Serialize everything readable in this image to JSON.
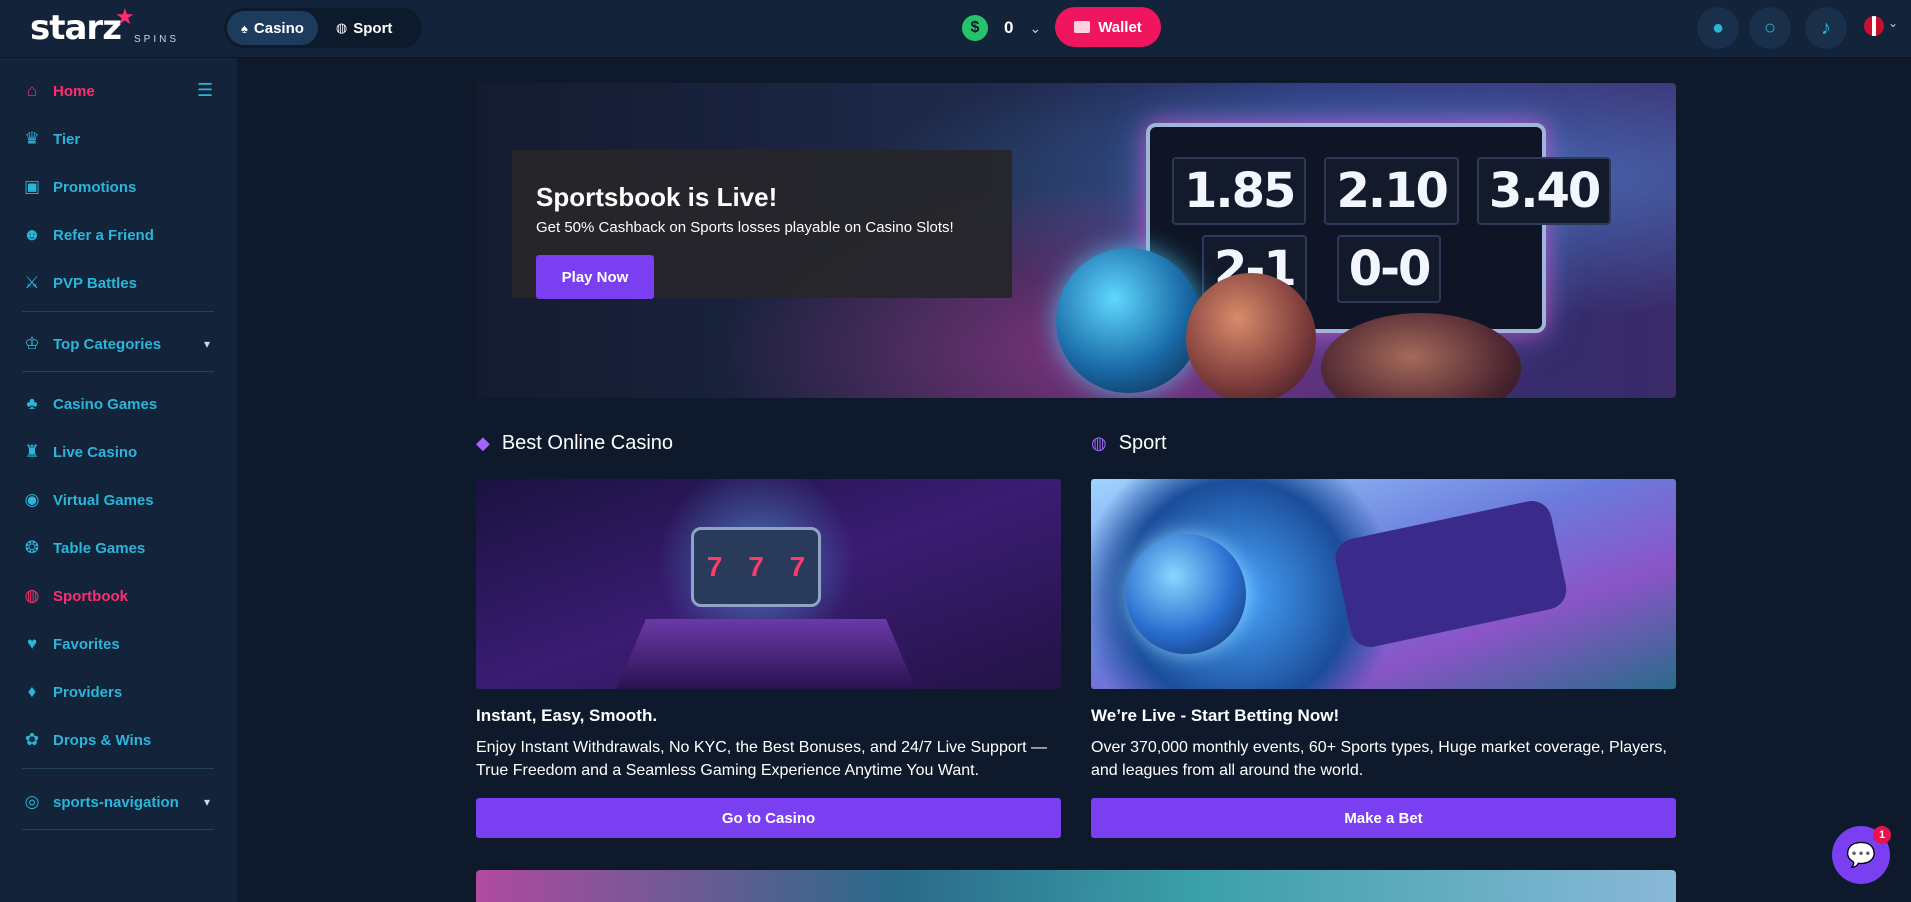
{
  "header": {
    "logo_text": "starz",
    "logo_sub": "SPINS",
    "tabs": [
      {
        "label": "Casino",
        "active": true
      },
      {
        "label": "Sport",
        "active": false
      }
    ],
    "balance": "0",
    "wallet_label": "Wallet"
  },
  "sidebar": {
    "items": [
      {
        "label": "Home",
        "icon": "home-icon",
        "active": true
      },
      {
        "label": "Tier",
        "icon": "trophy-icon"
      },
      {
        "label": "Promotions",
        "icon": "gift-icon"
      },
      {
        "label": "Refer a Friend",
        "icon": "users-icon"
      },
      {
        "label": "PVP Battles",
        "icon": "swords-icon"
      },
      {
        "label": "Top Categories",
        "icon": "crown-icon"
      },
      {
        "label": "Casino Games",
        "icon": "cherries-icon"
      },
      {
        "label": "Live Casino",
        "icon": "dealer-icon"
      },
      {
        "label": "Virtual Games",
        "icon": "gamepad-icon"
      },
      {
        "label": "Table Games",
        "icon": "chip-icon"
      },
      {
        "label": "Sportbook",
        "icon": "basketball-icon",
        "active": true
      },
      {
        "label": "Favorites",
        "icon": "heart-icon"
      },
      {
        "label": "Providers",
        "icon": "provider-icon"
      },
      {
        "label": "Drops & Wins",
        "icon": "drops-icon"
      },
      {
        "label": "sports-navigation",
        "icon": "sports-icon"
      }
    ]
  },
  "hero": {
    "title": "Sportsbook is Live!",
    "subtitle": "Get 50% Cashback on Sports losses playable on Casino Slots!",
    "button": "Play Now",
    "odds": [
      "1.85",
      "2.10",
      "3.40"
    ],
    "scores": [
      "2-1",
      "0-0"
    ]
  },
  "sections": {
    "casino": {
      "heading": "Best Online Casino",
      "title": "Instant, Easy, Smooth.",
      "description": "Enjoy Instant Withdrawals, No KYC, the Best Bonuses, and 24/7 Live Support — True Freedom and a Seamless Gaming Experience Anytime You Want.",
      "button": "Go to Casino",
      "slot_symbols": [
        "7",
        "7",
        "7"
      ]
    },
    "sport": {
      "heading": "Sport",
      "title": "We’re Live - Start Betting Now!",
      "description": "Over 370,000 monthly events, 60+ Sports types, Huge market coverage, Players, and leagues from all around the world.",
      "button": "Make a Bet"
    }
  },
  "chat": {
    "badge": "1"
  },
  "colors": {
    "accent_pink": "#f0155f",
    "accent_cyan": "#2ab5d9",
    "accent_purple": "#7a3ff0",
    "bg": "#0e1a2b"
  }
}
